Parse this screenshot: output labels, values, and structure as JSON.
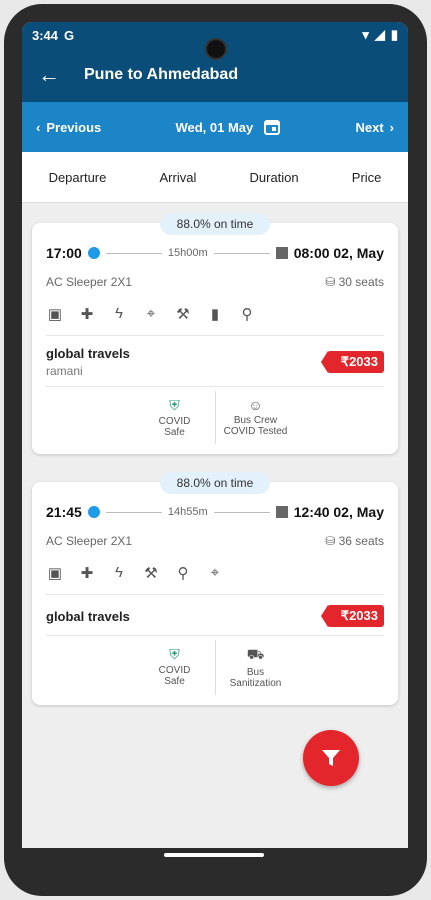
{
  "status": {
    "time": "3:44",
    "carrier_icon": "G"
  },
  "appbar": {
    "title": "Pune to Ahmedabad"
  },
  "datebar": {
    "prev_label": "Previous",
    "date": "Wed, 01 May",
    "next_label": "Next"
  },
  "sort": [
    "Departure",
    "Arrival",
    "Duration",
    "Price"
  ],
  "cards": [
    {
      "badge": "88.0% on time",
      "dep": "17:00",
      "duration": "15h00m",
      "arr": "08:00 02, May",
      "type": "AC Sleeper 2X1",
      "seats": "30 seats",
      "operator": "global travels",
      "sub": "ramani",
      "price": "₹2033",
      "features": [
        {
          "line1": "COVID",
          "line2": "Safe"
        },
        {
          "line1": "Bus Crew",
          "line2": "COVID Tested"
        }
      ]
    },
    {
      "badge": "88.0% on time",
      "dep": "21:45",
      "duration": "14h55m",
      "arr": "12:40 02, May",
      "type": "AC Sleeper 2X1",
      "seats": "36 seats",
      "operator": "global travels",
      "sub": "",
      "price": "₹2033",
      "features": [
        {
          "line1": "COVID",
          "line2": "Safe"
        },
        {
          "line1": "Bus",
          "line2": "Sanitization"
        }
      ]
    }
  ],
  "colors": {
    "primary": "#0a4d78",
    "accent": "#1b85c7",
    "price": "#e3262b"
  }
}
